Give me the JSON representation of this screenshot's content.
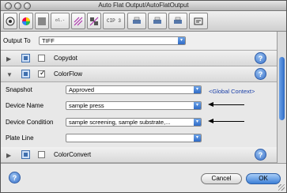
{
  "window": {
    "title": "Auto Flat Output/AutoFlatOutput"
  },
  "toolbar": {
    "items": [
      {
        "name": "target-icon"
      },
      {
        "name": "color-wheel-icon"
      },
      {
        "name": "gray-square-icon"
      },
      {
        "name": "layout-icon",
        "label": "ol.-"
      },
      {
        "name": "diagonal-icon"
      },
      {
        "name": "checker-icon"
      },
      {
        "name": "cip3-icon",
        "label": "CIP 3"
      },
      {
        "name": "printer-icon"
      },
      {
        "name": "printer2-icon"
      },
      {
        "name": "printer3-icon"
      },
      {
        "name": "layout2-icon"
      }
    ]
  },
  "output": {
    "label": "Output To",
    "value": "TIFF"
  },
  "panels": {
    "copydot": {
      "name": "Copydot",
      "checked": false
    },
    "colorflow": {
      "name": "ColorFlow",
      "checked": true
    },
    "colorconvert": {
      "name": "ColorConvert",
      "checked": false
    }
  },
  "fields": {
    "snapshot": {
      "label": "Snapshot",
      "value": "Approved",
      "context": "<Global Context>"
    },
    "device_name": {
      "label": "Device Name",
      "value": "sample press"
    },
    "device_condition": {
      "label": "Device Condition",
      "value": "sample screening, sample substrate,..."
    },
    "plate_line": {
      "label": "Plate Line",
      "value": ""
    }
  },
  "buttons": {
    "cancel": "Cancel",
    "ok": "OK",
    "help": "?"
  }
}
